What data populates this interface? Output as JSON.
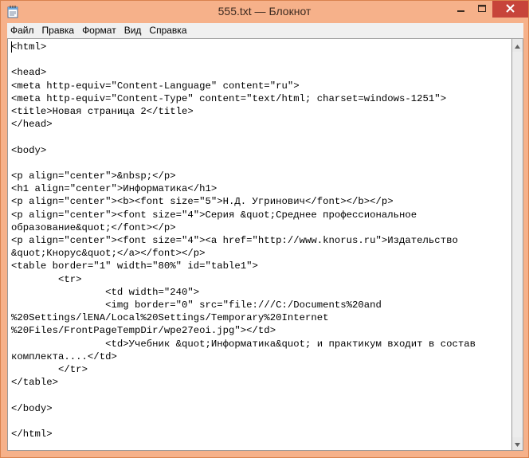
{
  "window": {
    "title": "555.txt — Блокнот",
    "frame_color": "#f6b18a",
    "close_button_color": "#c7443a"
  },
  "icons": {
    "app": "notepad-icon",
    "minimize": "minimize-icon",
    "maximize": "maximize-icon",
    "close": "close-icon",
    "scroll_up": "chevron-up-icon",
    "scroll_down": "chevron-down-icon"
  },
  "menu": {
    "file": "Файл",
    "edit": "Правка",
    "format": "Формат",
    "view": "Вид",
    "help": "Справка"
  },
  "document": {
    "text": "<html>\n\n<head>\n<meta http-equiv=\"Content-Language\" content=\"ru\">\n<meta http-equiv=\"Content-Type\" content=\"text/html; charset=windows-1251\">\n<title>Новая страница 2</title>\n</head>\n\n<body>\n\n<p align=\"center\">&nbsp;</p>\n<h1 align=\"center\">Информатика</h1>\n<p align=\"center\"><b><font size=\"5\">Н.Д. Угринович</font></b></p>\n<p align=\"center\"><font size=\"4\">Серия &quot;Среднее профессиональное\nобразование&quot;</font></p>\n<p align=\"center\"><font size=\"4\"><a href=\"http://www.knorus.ru\">Издательство\n&quot;Кнорус&quot;</a></font></p>\n<table border=\"1\" width=\"80%\" id=\"table1\">\n\t<tr>\n\t\t<td width=\"240\">\n\t\t<img border=\"0\" src=\"file:///C:/Documents%20and\n%20Settings/lENA/Local%20Settings/Temporary%20Internet\n%20Files/FrontPageTempDir/wpe27eoi.jpg\"></td>\n\t\t<td>Учебник &quot;Информатика&quot; и практикум входит в состав\nкомплекта....</td>\n\t</tr>\n</table>\n\n</body>\n\n</html>"
  }
}
